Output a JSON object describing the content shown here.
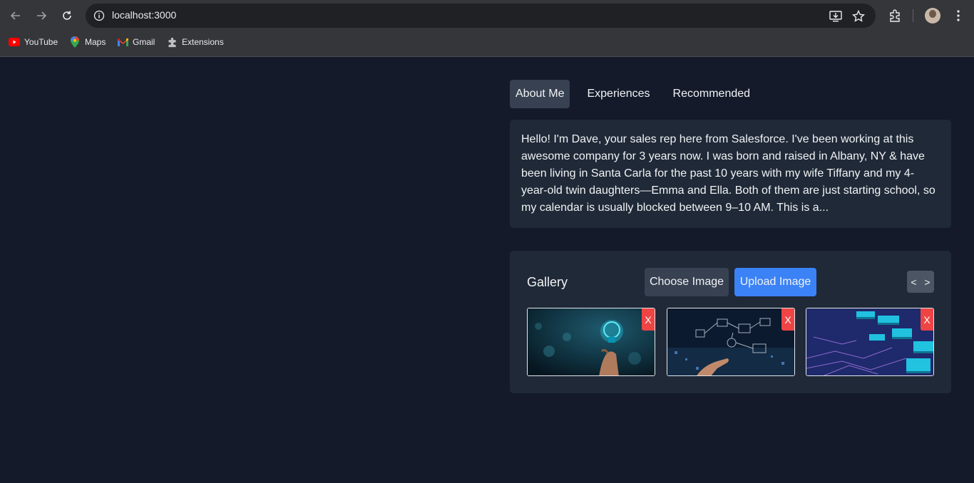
{
  "browser": {
    "url": "localhost:3000",
    "bookmarks": [
      {
        "label": "YouTube",
        "icon": "youtube-icon"
      },
      {
        "label": "Maps",
        "icon": "maps-icon"
      },
      {
        "label": "Gmail",
        "icon": "gmail-icon"
      },
      {
        "label": "Extensions",
        "icon": "puzzle-icon"
      }
    ]
  },
  "tabs": [
    {
      "label": "About Me",
      "active": true
    },
    {
      "label": "Experiences",
      "active": false
    },
    {
      "label": "Recommended",
      "active": false
    }
  ],
  "about": {
    "text": "Hello! I'm Dave, your sales rep here from Salesforce. I've been working at this awesome company for 3 years now. I was born and raised in Albany, NY & have been living in Santa Carla for the past 10 years with my wife Tiffany and my 4-year-old twin daughters—Emma and Ella. Both of them are just starting school, so my calendar is usually blocked between 9–10 AM. This is a..."
  },
  "gallery": {
    "title": "Gallery",
    "choose_label": "Choose Image",
    "upload_label": "Upload Image",
    "prev_label": "<",
    "next_label": ">",
    "delete_label": "X",
    "images": [
      {
        "alt": "lightbulb-hand"
      },
      {
        "alt": "digital-network-hand"
      },
      {
        "alt": "circuit-board"
      }
    ]
  },
  "colors": {
    "page_bg": "#141a2a",
    "card_bg": "#1f2937",
    "accent": "#3b82f6",
    "danger": "#ef4444"
  }
}
